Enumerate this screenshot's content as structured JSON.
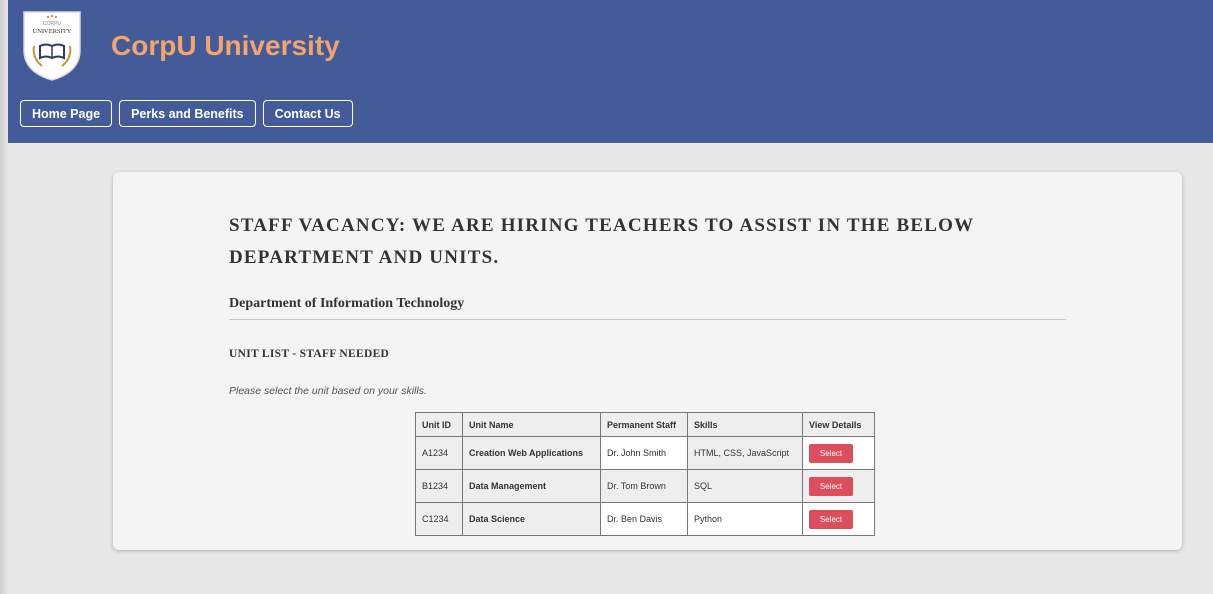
{
  "header": {
    "brand": "CorpU University",
    "logo": {
      "top_text": "CORPU",
      "main_text": "UNIVERSITY",
      "icon": "open-book-laurel-shield-icon"
    },
    "nav": [
      {
        "label": "Home Page"
      },
      {
        "label": "Perks and Benefits"
      },
      {
        "label": "Contact Us"
      }
    ]
  },
  "main": {
    "title": "STAFF VACANCY: WE ARE HIRING TEACHERS TO ASSIST IN THE BELOW DEPARTMENT AND UNITS.",
    "department": "Department of Information Technology",
    "unit_heading": "UNIT LIST - STAFF NEEDED",
    "instruction": "Please select the unit based on your skills.",
    "table": {
      "headers": [
        "Unit ID",
        "Unit Name",
        "Permanent Staff",
        "Skills",
        "View Details"
      ],
      "rows": [
        {
          "unit_id": "A1234",
          "unit_name": "Creation Web Applications",
          "staff": "Dr. John Smith",
          "skills": "HTML, CSS, JavaScript",
          "action": "Select"
        },
        {
          "unit_id": "B1234",
          "unit_name": "Data Management",
          "staff": "Dr. Tom Brown",
          "skills": "SQL",
          "action": "Select"
        },
        {
          "unit_id": "C1234",
          "unit_name": "Data Science",
          "staff": "Dr. Ben Davis",
          "skills": "Python",
          "action": "Select"
        }
      ]
    }
  },
  "colors": {
    "header_bg": "#445b99",
    "brand_text": "#f3a46a",
    "select_button": "#dc4e5b",
    "page_bg": "#e8e8e8",
    "card_bg": "#f4f4f4"
  }
}
